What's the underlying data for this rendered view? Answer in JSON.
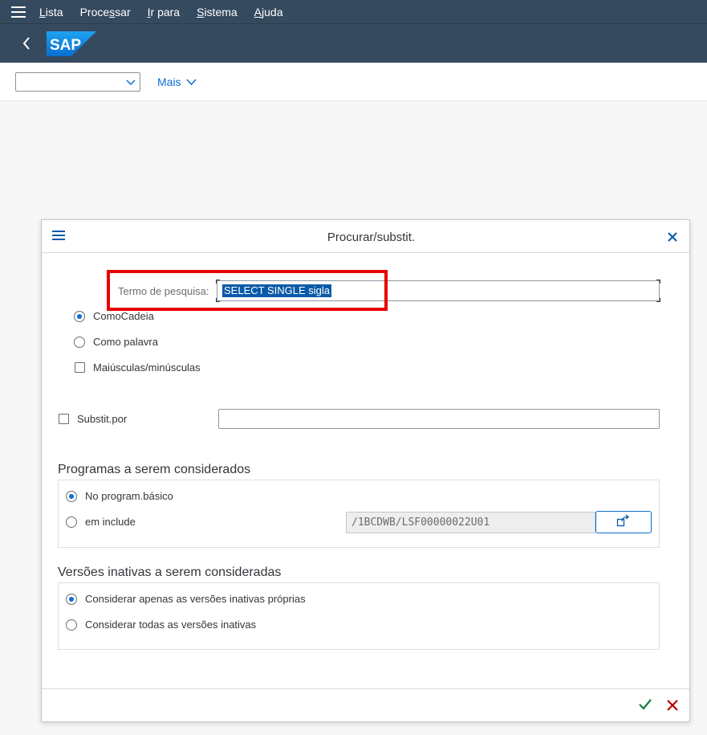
{
  "menubar": {
    "items": [
      {
        "mnemonic": "L",
        "rest": "ista"
      },
      {
        "pre": "Proce",
        "mnemonic": "s",
        "rest": "sar"
      },
      {
        "mnemonic": "I",
        "rest": "r para"
      },
      {
        "mnemonic": "S",
        "rest": "istema"
      },
      {
        "mnemonic": "A",
        "rest": "juda"
      }
    ]
  },
  "shell": {
    "logo_text": "SAP"
  },
  "toolbar": {
    "select_value": "",
    "more_label": "Mais"
  },
  "dialog": {
    "title": "Procurar/substit.",
    "search_label": "Termo de pesquisa:",
    "search_value": "SELECT SINGLE sigla",
    "options": {
      "as_string": "ComoCadeia",
      "as_word": "Como palavra",
      "case_sensitive": "Maiúsculas/minúsculas",
      "selected": "as_string"
    },
    "replace": {
      "label": "Substit.por",
      "value": "",
      "checked": false
    },
    "programs": {
      "title": "Programas a serem considerados",
      "basic": "No program.básico",
      "include": "em include",
      "include_value": "/1BCDWB/LSF00000022U01",
      "selected": "basic"
    },
    "inactive": {
      "title": "Versões inativas a serem consideradas",
      "own": "Considerar apenas as versões inativas próprias",
      "all": "Considerar todas as versões inativas",
      "selected": "own"
    }
  },
  "colors": {
    "shell_bg": "#354a5f",
    "accent": "#0a6ed1",
    "highlight_box": "#e80000",
    "ok": "#107e3e",
    "cancel": "#bb0000"
  }
}
